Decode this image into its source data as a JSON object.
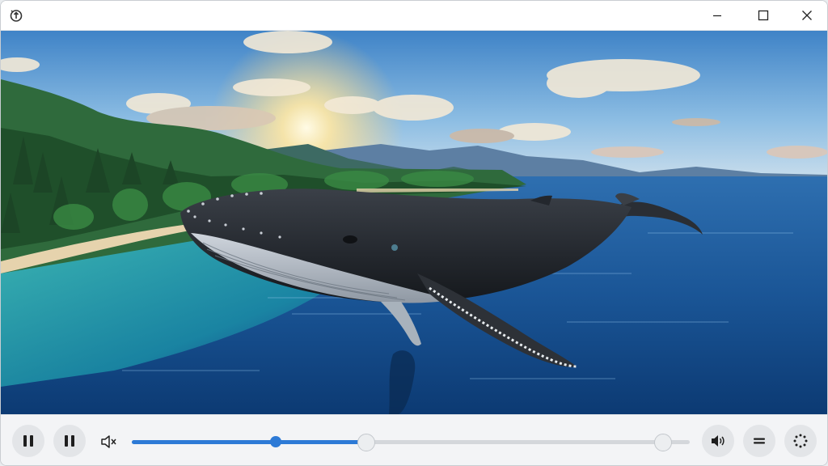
{
  "window": {
    "controls": [
      "minimize-icon",
      "maximize-icon",
      "close-icon"
    ]
  },
  "player": {
    "scene": "humpback-whale-over-coastal-bay",
    "progress": 0.258,
    "buffered": 0.42,
    "volume_marker": 0.952,
    "accent_color": "#2d7ad6"
  },
  "controls": {
    "left": [
      "pause-icon",
      "pause-icon"
    ],
    "right": [
      "speaker-volume-icon",
      "menu-icon",
      "loading-spinner-icon"
    ]
  }
}
